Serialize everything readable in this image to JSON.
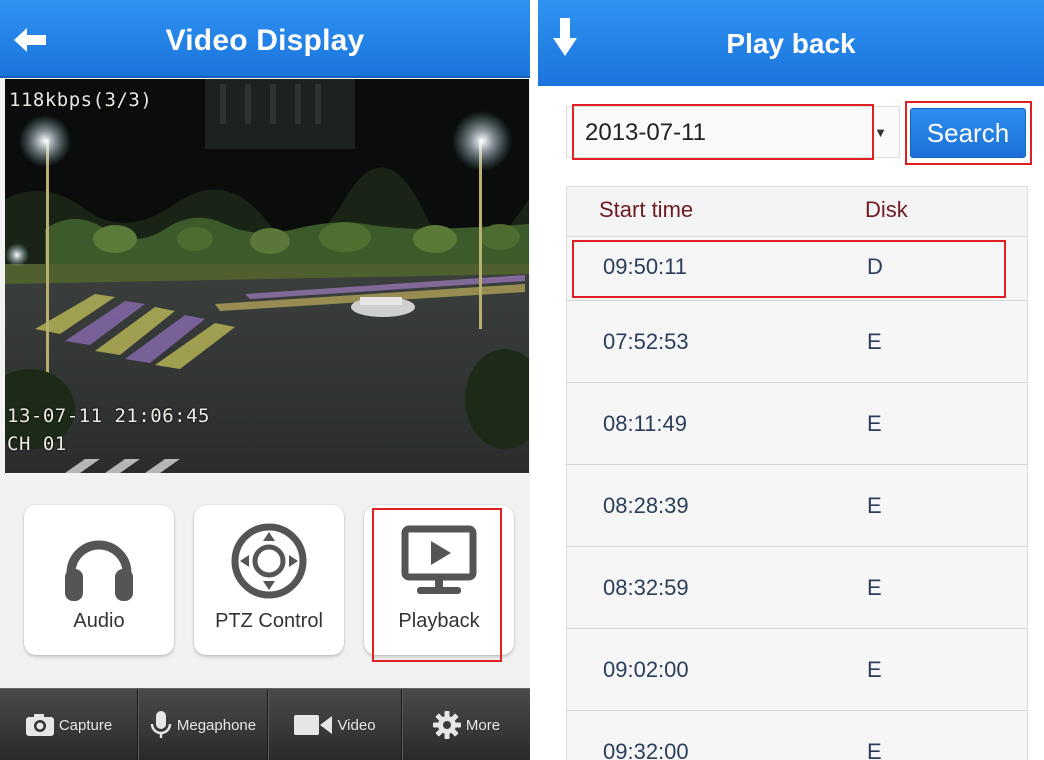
{
  "video_display": {
    "title": "Video Display",
    "osd_bitrate": "118kbps(3/3)",
    "osd_timestamp": "13-07-11 21:06:45",
    "osd_channel": "CH 01",
    "buttons": [
      {
        "label": "Audio",
        "icon": "headphones-icon"
      },
      {
        "label": "PTZ Control",
        "icon": "ptz-joystick-icon"
      },
      {
        "label": "Playback",
        "icon": "monitor-play-icon"
      }
    ],
    "toolbar": [
      {
        "label": "Capture",
        "icon": "camera-icon"
      },
      {
        "label": "Megaphone",
        "icon": "microphone-icon"
      },
      {
        "label": "Video",
        "icon": "video-camera-icon"
      },
      {
        "label": "More",
        "icon": "gear-icon"
      }
    ]
  },
  "playback": {
    "title": "Play back",
    "date_value": "2013-07-11",
    "search_label": "Search",
    "columns": [
      "Start time",
      "Disk"
    ],
    "rows": [
      {
        "time": "09:50:11",
        "disk": "D"
      },
      {
        "time": "07:52:53",
        "disk": "E"
      },
      {
        "time": "08:11:49",
        "disk": "E"
      },
      {
        "time": "08:28:39",
        "disk": "E"
      },
      {
        "time": "08:32:59",
        "disk": "E"
      },
      {
        "time": "09:02:00",
        "disk": "E"
      },
      {
        "time": "09:32:00",
        "disk": "E"
      }
    ]
  },
  "colors": {
    "nav_blue": "#1f7fe6",
    "highlight_red": "#e02020",
    "table_header_text": "#6e1a22",
    "table_row_text": "#2a3d5a"
  }
}
